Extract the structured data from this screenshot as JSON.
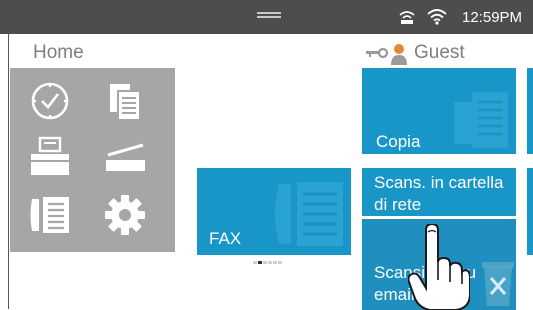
{
  "status": {
    "time": "12:59PM"
  },
  "header": {
    "home_label": "Home",
    "user_label": "Guest"
  },
  "tiles": {
    "copia": "Copia",
    "scan_cartella": "Scans. in cartella di rete",
    "scan_email": "Scansione su email",
    "fax": "FAX"
  },
  "pager": {
    "pages": 6,
    "current": 1
  },
  "colors": {
    "status_bar": "#4d4d4d",
    "tile_blue": "#1996c8",
    "panel_gray": "#a6a6a6"
  },
  "icons": [
    "clock-icon",
    "copy-doc-icon",
    "printer-icon",
    "scanner-icon",
    "fax-phone-icon",
    "settings-gear-icon",
    "key-icon",
    "person-icon",
    "wifi-icon",
    "network-icon",
    "trash-icon",
    "touch-hand-icon"
  ]
}
